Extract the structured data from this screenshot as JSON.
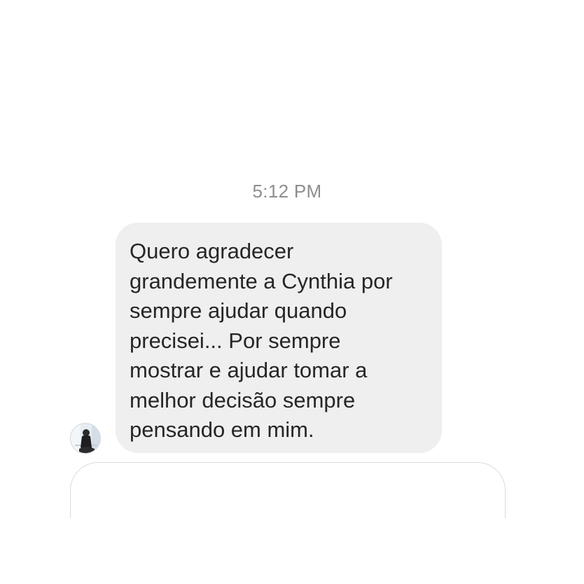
{
  "thread": {
    "timestamp": "5:12 PM",
    "messages": [
      {
        "direction": "incoming",
        "text": "Quero agradecer\ngrandemente a Cynthia por\nsempre ajudar quando\nprecisei... Por sempre\nmostrar e ajudar tomar a\nmelhor decisão sempre\npensando em mim."
      }
    ]
  },
  "colors": {
    "bubble_background": "#efefef",
    "message_text": "#262626",
    "timestamp_text": "#8e8e8e",
    "composer_border": "#dbdbdb"
  },
  "icons": {
    "sender_avatar": "avatar-photo"
  }
}
